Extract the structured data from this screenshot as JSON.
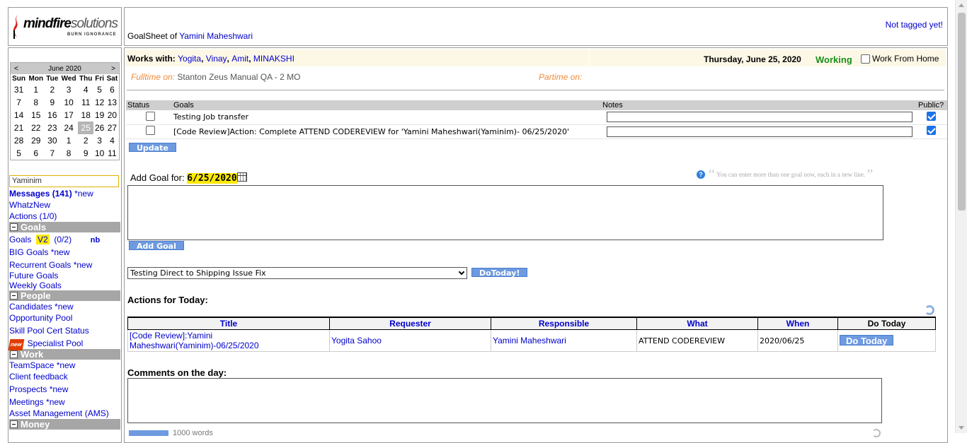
{
  "logo": {
    "brand_main": "mindfire",
    "brand_sub": "solutions",
    "tagline": "BURN IGNORANCE"
  },
  "header": {
    "title_prefix": "GoalSheet of",
    "user_name": "Yamini Maheshwari",
    "tag_status": "Not tagged yet!"
  },
  "calendar": {
    "prev": "<",
    "next": ">",
    "month_label": "June 2020",
    "weekdays": [
      "Sun",
      "Mon",
      "Tue",
      "Wed",
      "Thu",
      "Fri",
      "Sat"
    ],
    "weeks": [
      [
        "31",
        "1",
        "2",
        "3",
        "4",
        "5",
        "6"
      ],
      [
        "7",
        "8",
        "9",
        "10",
        "11",
        "12",
        "13"
      ],
      [
        "14",
        "15",
        "16",
        "17",
        "18",
        "19",
        "20"
      ],
      [
        "21",
        "22",
        "23",
        "24",
        "25",
        "26",
        "27"
      ],
      [
        "28",
        "29",
        "30",
        "1",
        "2",
        "3",
        "4"
      ],
      [
        "5",
        "6",
        "7",
        "8",
        "9",
        "10",
        "11"
      ]
    ],
    "today": "25"
  },
  "sidebar": {
    "search_value": "Yaminim",
    "messages": "Messages (141)",
    "messages_new": "*new",
    "whatznew": "WhatzNew",
    "actions": "Actions (1/0)",
    "sections": {
      "goals": "Goals",
      "people": "People",
      "work": "Work",
      "money": "Money"
    },
    "goals_link": "Goals",
    "goals_v2": "V2",
    "goals_count": "(0/2)",
    "goals_nb": "nb",
    "big_goals": "BIG Goals *new",
    "recurrent_goals": "Recurrent Goals *new",
    "future_goals": "Future Goals",
    "weekly_goals": "Weekly Goals",
    "candidates": "Candidates *new",
    "opportunity_pool": "Opportunity Pool",
    "skill_pool": "Skill Pool Cert Status",
    "new_badge": "new",
    "specialist_pool": "Specialist Pool",
    "teamspace": "TeamSpace *new",
    "client_feedback": "Client feedback",
    "prospects": "Prospects *new",
    "meetings": "Meetings *new",
    "asset_mgmt": "Asset Management (AMS)"
  },
  "works": {
    "label": "Works with:",
    "people": [
      "Yogita",
      "Vinay",
      "Amit",
      "MINAKSHI"
    ],
    "date": "Thursday, June 25, 2020",
    "status": "Working",
    "wfh_label": "Work From Home",
    "fulltime_label": "Fulltime on:",
    "fulltime_value": "Stanton Zeus Manual QA - 2 MO",
    "parttime_label": "Partime on:"
  },
  "goals_table": {
    "headers": {
      "status": "Status",
      "goals": "Goals",
      "notes": "Notes",
      "public": "Public?"
    },
    "rows": [
      {
        "goal": "Testing Job transfer",
        "public": true
      },
      {
        "goal": "[Code Review]Action: Complete ATTEND CODEREVIEW for 'Yamini Maheshwari(Yaminim)- 06/25/2020'",
        "public": true
      }
    ],
    "update_label": "Update"
  },
  "add_goal": {
    "label": "Add Goal for:",
    "date": "6/25/2020",
    "help_mark": "?",
    "tip": "You can enter more than one goal now, each in a new line.",
    "button": "Add Goal"
  },
  "do_today": {
    "selected": "Testing Direct to Shipping Issue Fix",
    "button": "DoToday!"
  },
  "actions": {
    "label": "Actions for Today:",
    "headers": [
      "Title",
      "Requester",
      "Responsible",
      "What",
      "When",
      "Do Today"
    ],
    "rows": [
      {
        "title": "[Code Review]:Yamini Maheshwari(Yaminim)-06/25/2020",
        "requester": "Yogita Sahoo",
        "responsible": "Yamini Maheshwari",
        "what": "ATTEND CODEREVIEW",
        "when": "2020/06/25",
        "do_today": "Do Today"
      }
    ]
  },
  "comments": {
    "label": "Comments on the day:",
    "counter": "1000 words"
  },
  "colors": {
    "accent_button": "#6d9ae0",
    "link": "#0000cc",
    "section_header": "#a6a6a6",
    "highlight": "#ffea00",
    "working": "#1a8f1a",
    "orange_label": "#f08b3c"
  }
}
